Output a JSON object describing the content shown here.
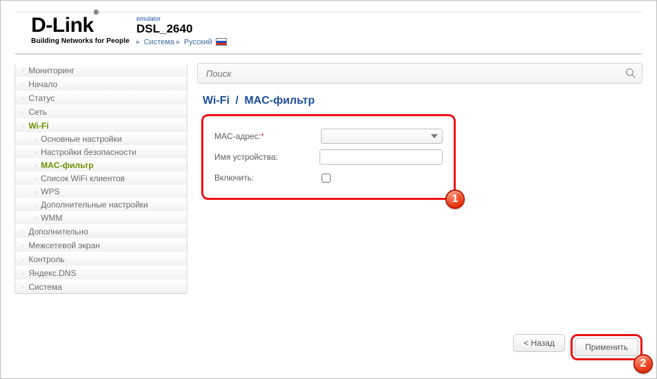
{
  "brand": {
    "name": "D-Link",
    "tagline": "Building Networks for People"
  },
  "device": {
    "emulator_label": "emulator",
    "model": "DSL_2640",
    "breadcrumb": {
      "system": "Система",
      "lang": "Русский"
    }
  },
  "search": {
    "placeholder": "Поиск"
  },
  "sidebar": {
    "items": [
      {
        "label": "Мониторинг"
      },
      {
        "label": "Начало"
      },
      {
        "label": "Статус"
      },
      {
        "label": "Сеть"
      },
      {
        "label": "Wi-Fi",
        "active": true,
        "children": [
          {
            "label": "Основные настройки"
          },
          {
            "label": "Настройки безопасности"
          },
          {
            "label": "MAC-фильтр",
            "active": true
          },
          {
            "label": "Список WiFi клиентов"
          },
          {
            "label": "WPS"
          },
          {
            "label": "Дополнительные настройки"
          },
          {
            "label": "WMM"
          }
        ]
      },
      {
        "label": "Дополнительно"
      },
      {
        "label": "Межсетевой экран"
      },
      {
        "label": "Контроль"
      },
      {
        "label": "Яндекс.DNS"
      },
      {
        "label": "Система"
      }
    ]
  },
  "page_title": {
    "section": "Wi-Fi",
    "sep": "/",
    "page": "MAC-фильтр"
  },
  "form": {
    "mac_label": "MAC-адрес:",
    "mac_value": "",
    "device_name_label": "Имя устройства:",
    "device_name_value": "",
    "enable_label": "Включить:",
    "enable_checked": false
  },
  "buttons": {
    "back": "< Назад",
    "apply": "Применить"
  },
  "callouts": {
    "one": "1",
    "two": "2"
  }
}
